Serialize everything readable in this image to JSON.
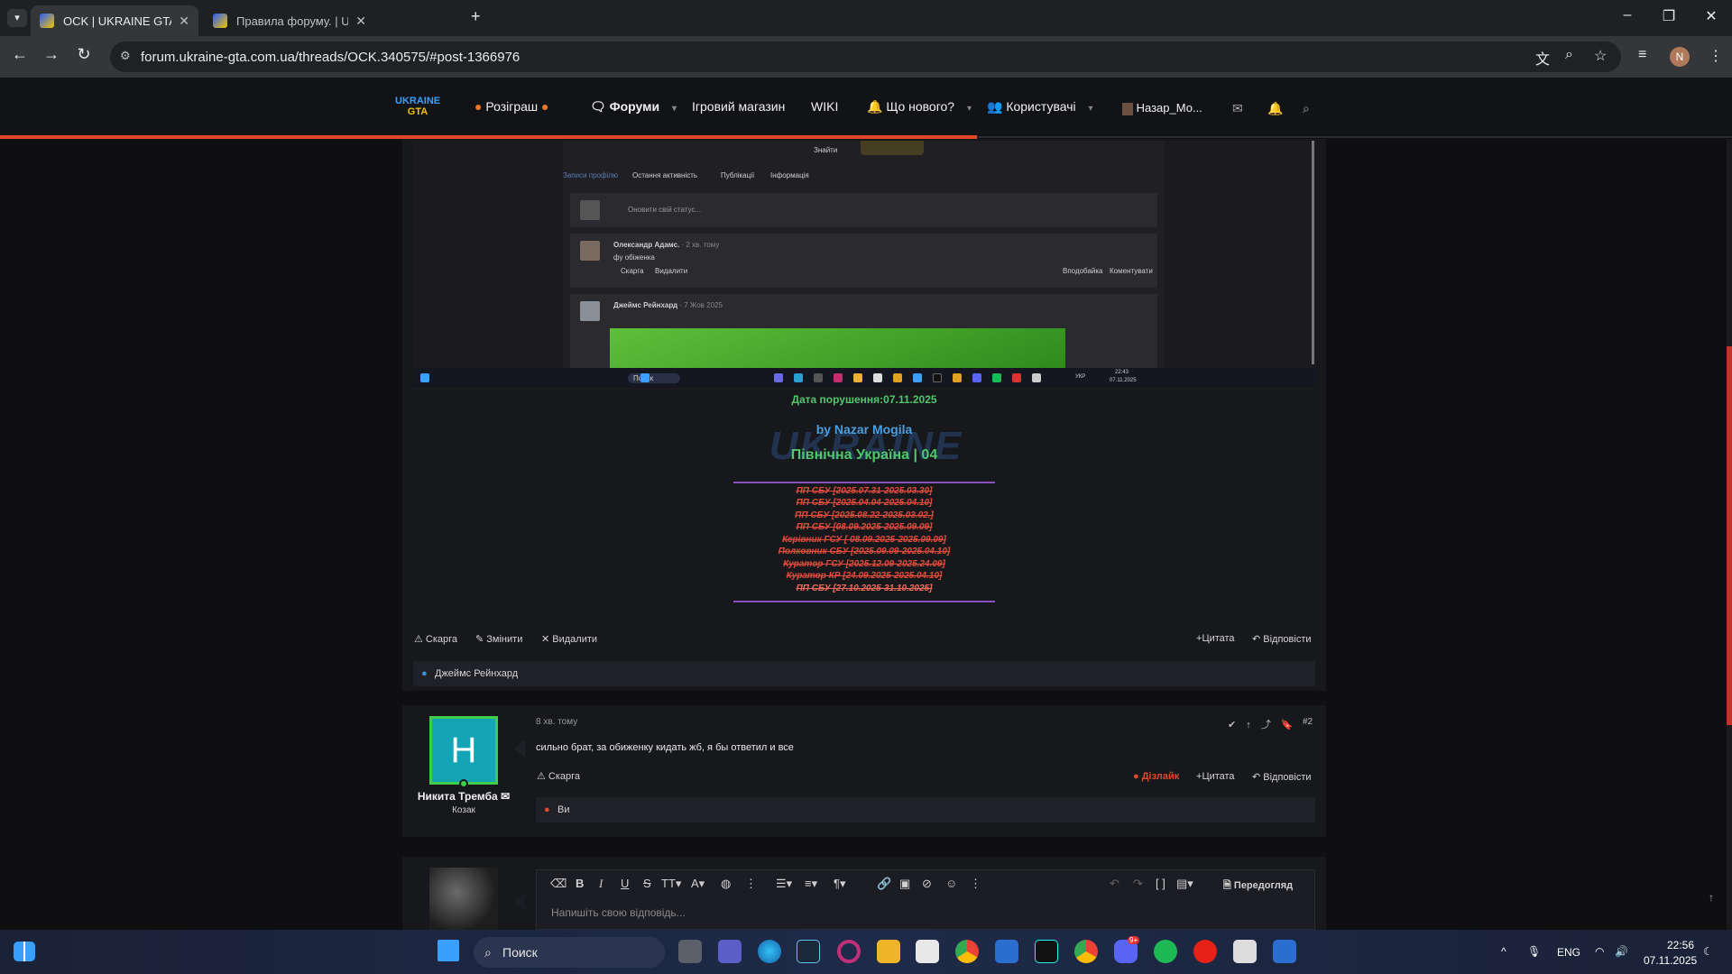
{
  "browser": {
    "tabs": [
      {
        "title": "OCK | UKRAINE GTA - Ігровий ф",
        "active": true
      },
      {
        "title": "Правила форуму. | UKRAINE G",
        "active": false
      }
    ],
    "new_tab": "+",
    "url": "forum.ukraine-gta.com.ua/threads/OCK.340575/#post-1366976",
    "profile_initial": "N"
  },
  "site": {
    "logo_top": "UKRAINE",
    "logo_bottom": "GTA",
    "nav": {
      "giveaway": "Розіграш",
      "forums": "Форуми",
      "shop": "Ігровий магазин",
      "wiki": "WIKI",
      "whats_new": "Що нового?",
      "users": "Користувачі",
      "username": "Назар_Мо..."
    }
  },
  "screenshot": {
    "find_label": "Знайти",
    "profile_tabs": [
      "Записи профілю",
      "Остання активність",
      "Публікації",
      "Інформація"
    ],
    "status_placeholder": "Оновити свій статус...",
    "post1_author": "Олександр Адамс.",
    "post1_time": "· 2 хв. тому",
    "post1_text": "фу обіженка",
    "post1_actions": [
      "Скарга",
      "Видалити"
    ],
    "post1_right_actions": [
      "Вподобайка",
      "Коментувати"
    ],
    "post2_author": "Джеймс Рейнхард",
    "post2_time": "· 7 Жов 2025",
    "taskbar_search": "Поиск",
    "taskbar_lang": "УКР",
    "taskbar_time": "22:43",
    "taskbar_date": "07.11.2025"
  },
  "post1": {
    "violation_date": "Дата порушення:07.11.2025",
    "signature_by": "by Nazar Mogila",
    "signature_server": "Північна Україна | 04",
    "watermark": "UKRAINE",
    "signature_lines": [
      "ПП СБУ [2025.07.31-2025.03.30]",
      "ПП СБУ [2025.04.04-2025.04.10]",
      "ПП СБУ [2025.08.22-2025.03.02.]",
      "ПП СБУ [08.09.2025-2025.09.09]",
      "Керівник ГСУ [ 08.09.2025-2025.09.09]",
      "Полковник СБУ [2025.09.09-2025.04.10]",
      "Куратор ГСУ [2025.12.09-2025.24.09]",
      "Куратор КР [24.09.2025-2025.04.10]",
      "ПП СБУ [27.10.2025-31.10.2025]"
    ],
    "actions_left": [
      "Скарга",
      "Змінити",
      "Видалити"
    ],
    "actions_right": [
      "Цитата",
      "Відповісти"
    ],
    "reaction_user": "Джеймс Рейнхард"
  },
  "post2": {
    "author_initial": "H",
    "author": "Никита Тремба",
    "rank": "Козак",
    "time": "8 хв. тому",
    "number": "#2",
    "text": "сильно брат, за обиженку кидать жб, я бы ответил и все",
    "report": "Скарга",
    "dislike": "Дізлайк",
    "quote": "Цитата",
    "reply": "Відповісти",
    "reaction_user": "Ви"
  },
  "editor": {
    "preview": "Передогляд",
    "placeholder": "Напишіть свою відповідь..."
  },
  "taskbar": {
    "search": "Поиск",
    "lang": "ENG",
    "time": "22:56",
    "date": "07.11.2025",
    "discord_badge": "9+"
  },
  "colors": {
    "accent_red": "#e2462b",
    "green_text": "#4fc76a",
    "blue_text": "#4a9fe0",
    "strike_red": "#e34b3b",
    "purple_rule": "#8a4fc2"
  }
}
